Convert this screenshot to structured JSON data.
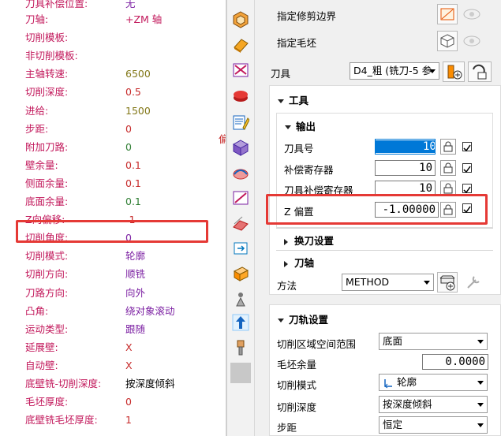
{
  "colors": {
    "label": "#c2185b",
    "value_red": "#d32f2f",
    "value_green": "#2e7d32",
    "value_olive": "#827717",
    "value_purple": "#7b1fa2",
    "value_blue": "#1565c0",
    "highlight": "#e53935",
    "selection": "#0078d7"
  },
  "params": [
    {
      "label": "刀具补偿位置:",
      "value": "无",
      "vc": "#7b1fa2"
    },
    {
      "label": "刀轴:",
      "value": "+ZM 轴",
      "vc": "#c2185b"
    },
    {
      "label": "切削模板:",
      "value": "",
      "vc": "#000"
    },
    {
      "label": "非切削模板:",
      "value": "",
      "vc": "#000"
    },
    {
      "label": "主轴转速:",
      "value": "6500",
      "vc": "#827717"
    },
    {
      "label": "切削深度:",
      "value": "0.5",
      "vc": "#c62828"
    },
    {
      "label": "进给:",
      "value": "1500",
      "vc": "#827717"
    },
    {
      "label": "步距:",
      "value": "0",
      "vc": "#c62828"
    },
    {
      "label": "附加刀路:",
      "value": "0",
      "vc": "#2e7d32"
    },
    {
      "label": "壁余量:",
      "value": "0.1",
      "vc": "#c62828"
    },
    {
      "label": "侧面余量:",
      "value": "0.1",
      "vc": "#c62828"
    },
    {
      "label": "底面余量:",
      "value": "0.1",
      "vc": "#2e7d32"
    },
    {
      "label": "Z向偏移:",
      "value": "-1",
      "vc": "#c62828"
    },
    {
      "label": "切削角度:",
      "value": "0",
      "vc": "#7b1fa2"
    },
    {
      "label": "切削模式:",
      "value": "轮廓",
      "vc": "#7b1fa2"
    },
    {
      "label": "切削方向:",
      "value": "顺铣",
      "vc": "#7b1fa2"
    },
    {
      "label": "刀路方向:",
      "value": "向外",
      "vc": "#7b1fa2"
    },
    {
      "label": "凸角:",
      "value": "绕对象滚动",
      "vc": "#7b1fa2"
    },
    {
      "label": "运动类型:",
      "value": "跟随",
      "vc": "#7b1fa2"
    },
    {
      "label": "延展壁:",
      "value": "X",
      "vc": "#c62828"
    },
    {
      "label": "自动壁:",
      "value": "X",
      "vc": "#c62828"
    },
    {
      "label": "底壁铣-切削深度:",
      "value": "按深度倾斜",
      "vc": "#000"
    },
    {
      "label": "毛坯厚度:",
      "value": "0",
      "vc": "#c62828"
    },
    {
      "label": "底壁铣毛坯厚度:",
      "value": "1",
      "vc": "#c62828"
    }
  ],
  "side_label": "偏",
  "geometry": {
    "trim_boundary_label": "指定修剪边界",
    "blank_label": "指定毛坯"
  },
  "tool": {
    "label": "刀具",
    "selected": "D4_粗 (铣刀-5 参",
    "section_title": "工具",
    "output": {
      "title": "输出",
      "rows": [
        {
          "label": "刀具号",
          "value": "10"
        },
        {
          "label": "补偿寄存器",
          "value": "10"
        },
        {
          "label": "刀具补偿寄存器",
          "value": "10"
        },
        {
          "label": "Z 偏置",
          "value": "-1.00000"
        }
      ]
    },
    "tool_change": "换刀设置",
    "tool_axis": "刀轴"
  },
  "method": {
    "label": "方法",
    "value": "METHOD"
  },
  "path_settings": {
    "title": "刀轨设置",
    "rows": [
      {
        "label": "切削区域空间范围",
        "value": "底面"
      },
      {
        "label": "毛坯余量",
        "value": "0.0000"
      },
      {
        "label": "切削模式",
        "value": "轮廓"
      },
      {
        "label": "切削深度",
        "value": "按深度倾斜"
      },
      {
        "label": "步距",
        "value": "恒定"
      }
    ]
  }
}
